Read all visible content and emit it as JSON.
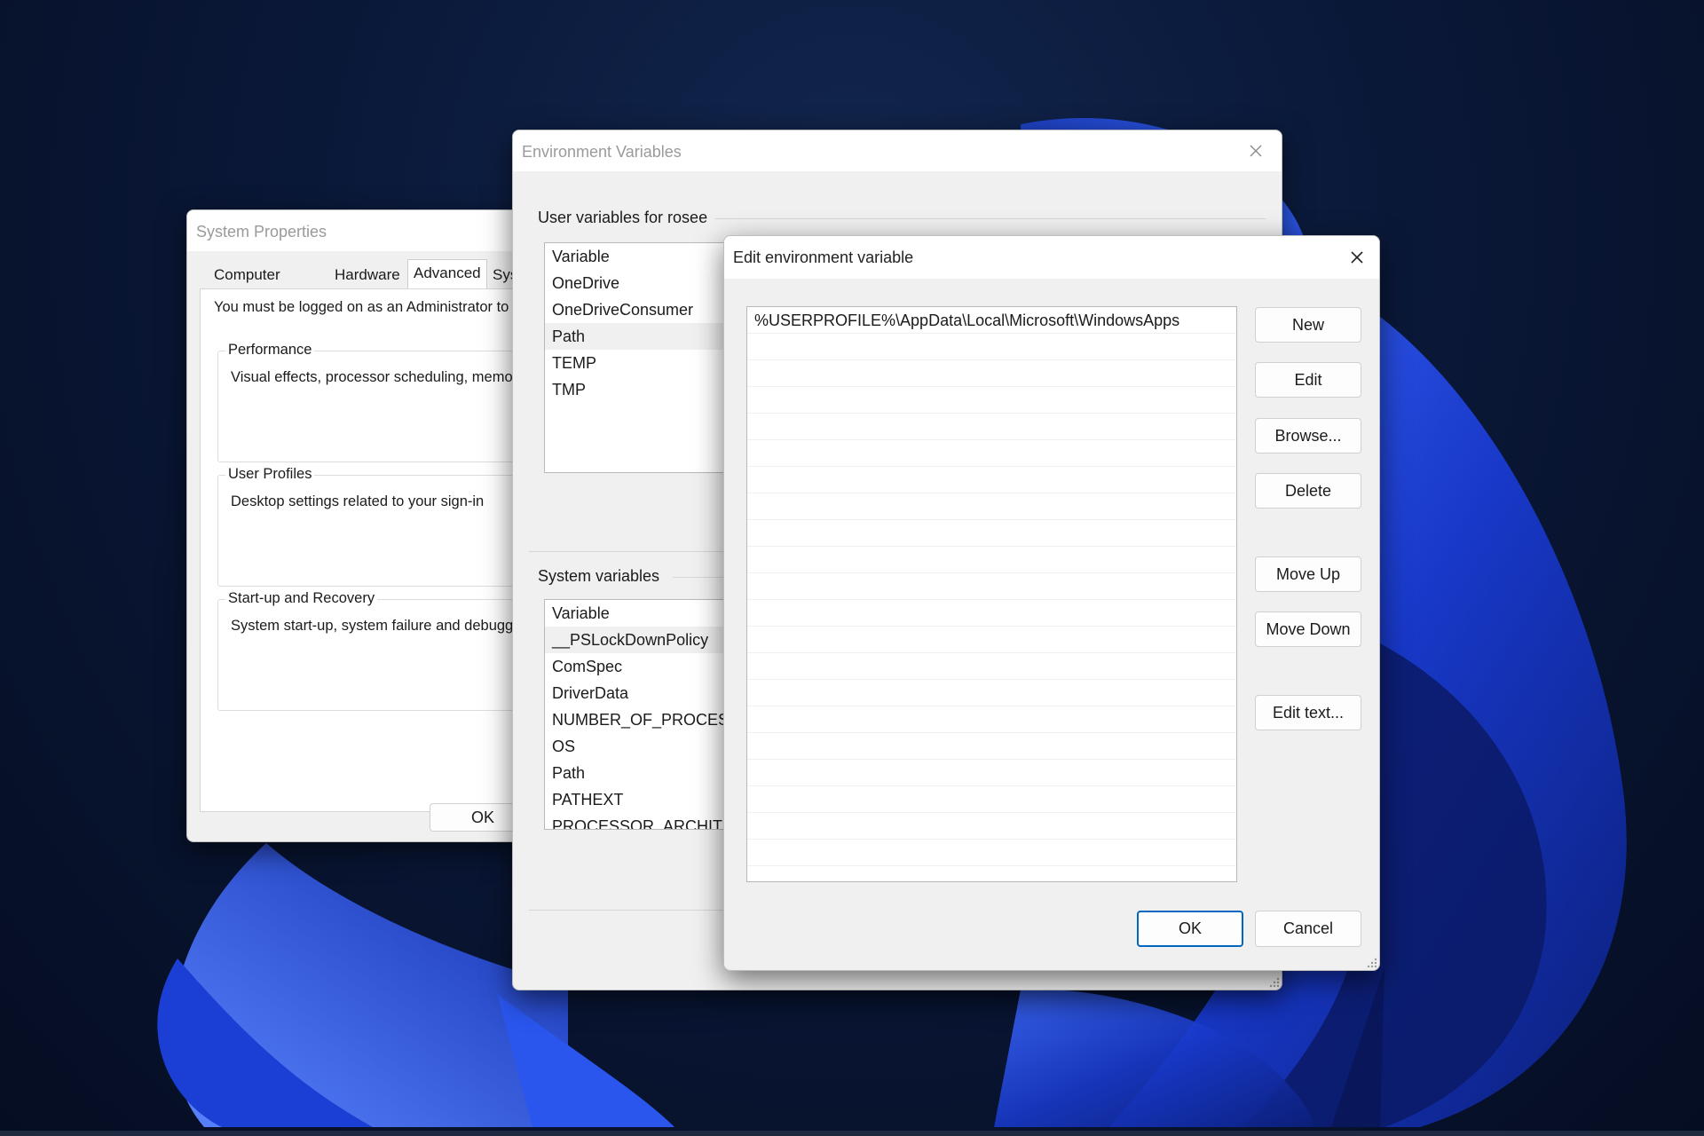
{
  "system_properties": {
    "title": "System Properties",
    "tabs": [
      {
        "label": "Computer Name"
      },
      {
        "label": "Hardware"
      },
      {
        "label": "Advanced"
      },
      {
        "label": "Syst"
      }
    ],
    "active_tab": "Advanced",
    "admin_note": "You must be logged on as an Administrator to",
    "groups": [
      {
        "label": "Performance",
        "desc": "Visual effects, processor scheduling, memo"
      },
      {
        "label": "User Profiles",
        "desc": "Desktop settings related to your sign-in"
      },
      {
        "label": "Start-up and Recovery",
        "desc": "System start-up, system failure and debuggi"
      }
    ],
    "ok_label": "OK"
  },
  "env_vars": {
    "title": "Environment Variables",
    "user_section_title": "User variables for rosee",
    "user_variables": [
      {
        "label": "Variable"
      },
      {
        "label": "OneDrive"
      },
      {
        "label": "OneDriveConsumer"
      },
      {
        "label": "Path"
      },
      {
        "label": "TEMP"
      },
      {
        "label": "TMP"
      }
    ],
    "user_selected": "Path",
    "system_section_title": "System variables",
    "system_variables": [
      {
        "label": "Variable"
      },
      {
        "label": "__PSLockDownPolicy"
      },
      {
        "label": "ComSpec"
      },
      {
        "label": "DriverData"
      },
      {
        "label": "NUMBER_OF_PROCESSO"
      },
      {
        "label": "OS"
      },
      {
        "label": "Path"
      },
      {
        "label": "PATHEXT"
      },
      {
        "label": "PROCESSOR_ARCHITECTURE"
      }
    ],
    "system_selected": "__PSLockDownPolicy"
  },
  "edit_var": {
    "title": "Edit environment variable",
    "entries": [
      "%USERPROFILE%\\AppData\\Local\\Microsoft\\WindowsApps"
    ],
    "buttons": {
      "new": "New",
      "edit": "Edit",
      "browse": "Browse...",
      "delete": "Delete",
      "move_up": "Move Up",
      "move_down": "Move Down",
      "edit_text": "Edit text..."
    },
    "ok_label": "OK",
    "cancel_label": "Cancel"
  },
  "icons": {
    "close": "close-icon",
    "resize_grip": "resize-grip-icon"
  },
  "colors": {
    "accent": "#0067c0",
    "window_bg": "#f0f0f0",
    "desktop_bg": "#0a1838",
    "wallpaper_blue": "#1a44d8"
  }
}
